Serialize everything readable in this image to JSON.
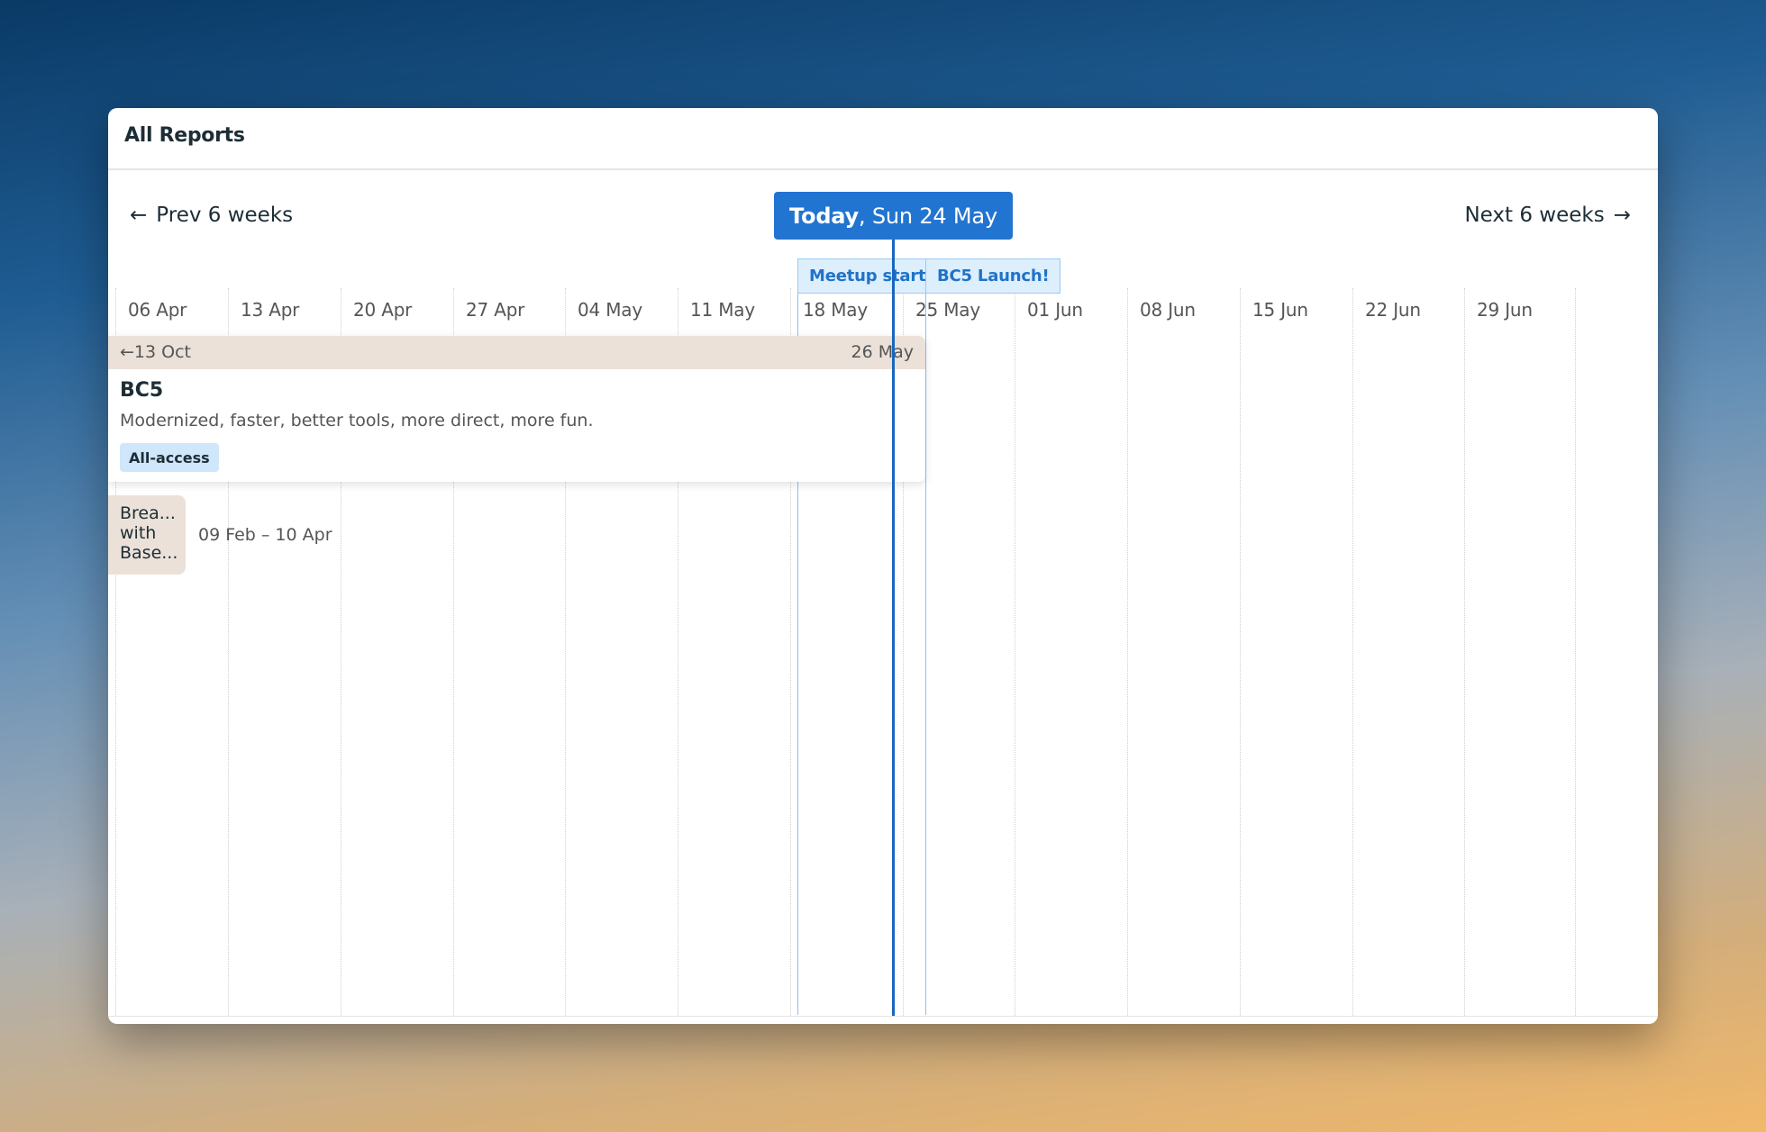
{
  "window": {
    "title": "All Reports"
  },
  "nav": {
    "prev_arrow": "←",
    "prev_label": "Prev 6 weeks",
    "next_label": "Next 6 weeks",
    "next_arrow": "→"
  },
  "today": {
    "prefix": "Today",
    "date": ", Sun 24 May"
  },
  "weeks": [
    "06 Apr",
    "13 Apr",
    "20 Apr",
    "27 Apr",
    "04 May",
    "11 May",
    "18 May",
    "25 May",
    "01 Jun",
    "08 Jun",
    "15 Jun",
    "22 Jun",
    "29 Jun"
  ],
  "milestones": [
    {
      "label": "Meetup starts"
    },
    {
      "label": "BC5 Launch!"
    }
  ],
  "projects": [
    {
      "range_start": "←13 Oct",
      "range_end": "26 May",
      "title": "BC5",
      "description": "Modernized, faster, better tools, more direct, more fun.",
      "badge": "All-access"
    },
    {
      "title_truncated": "Brea...\nwith\nBase...",
      "range": "09 Feb – 10 Apr"
    }
  ],
  "colors": {
    "accent": "#2274d1",
    "today_line": "#1a66bf",
    "milestone_bg": "#ddeefc",
    "milestone_text": "#1e73c9",
    "range_bar": "#ebe1d9",
    "badge_bg": "#cfe6fb"
  }
}
